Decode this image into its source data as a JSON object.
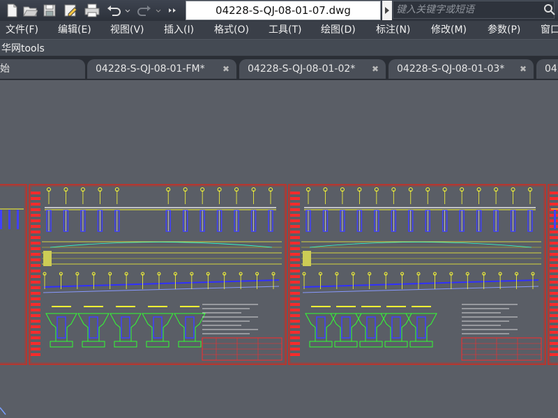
{
  "window": {
    "title": "04228-S-QJ-08-01-07.dwg",
    "search_placeholder": "键入关键字或短语"
  },
  "quick_access": [
    {
      "name": "new-file-icon"
    },
    {
      "name": "open-folder-icon"
    },
    {
      "name": "save-icon"
    },
    {
      "name": "save-as-icon"
    },
    {
      "name": "print-icon"
    },
    {
      "name": "undo-icon"
    },
    {
      "name": "redo-icon"
    },
    {
      "name": "more-icon"
    }
  ],
  "menu": [
    "文件(F)",
    "编辑(E)",
    "视图(V)",
    "插入(I)",
    "格式(O)",
    "工具(T)",
    "绘图(D)",
    "标注(N)",
    "修改(M)",
    "参数(P)",
    "窗口"
  ],
  "plugin_bar": {
    "label": "华网tools"
  },
  "tabs": [
    {
      "label": "始",
      "close": ""
    },
    {
      "label": "04228-S-QJ-08-01-FM*",
      "close": "✖"
    },
    {
      "label": "04228-S-QJ-08-01-02*",
      "close": "✖"
    },
    {
      "label": "04228-S-QJ-08-01-03*",
      "close": "✖"
    },
    {
      "label": "042",
      "close": ""
    }
  ],
  "drawing": {
    "frame_color": "#d32a1e",
    "title_block_color": "#ff2a2a",
    "pier_color": "#ffff33",
    "bearing_color": "#4040ff",
    "section_color": "#33ff33"
  }
}
